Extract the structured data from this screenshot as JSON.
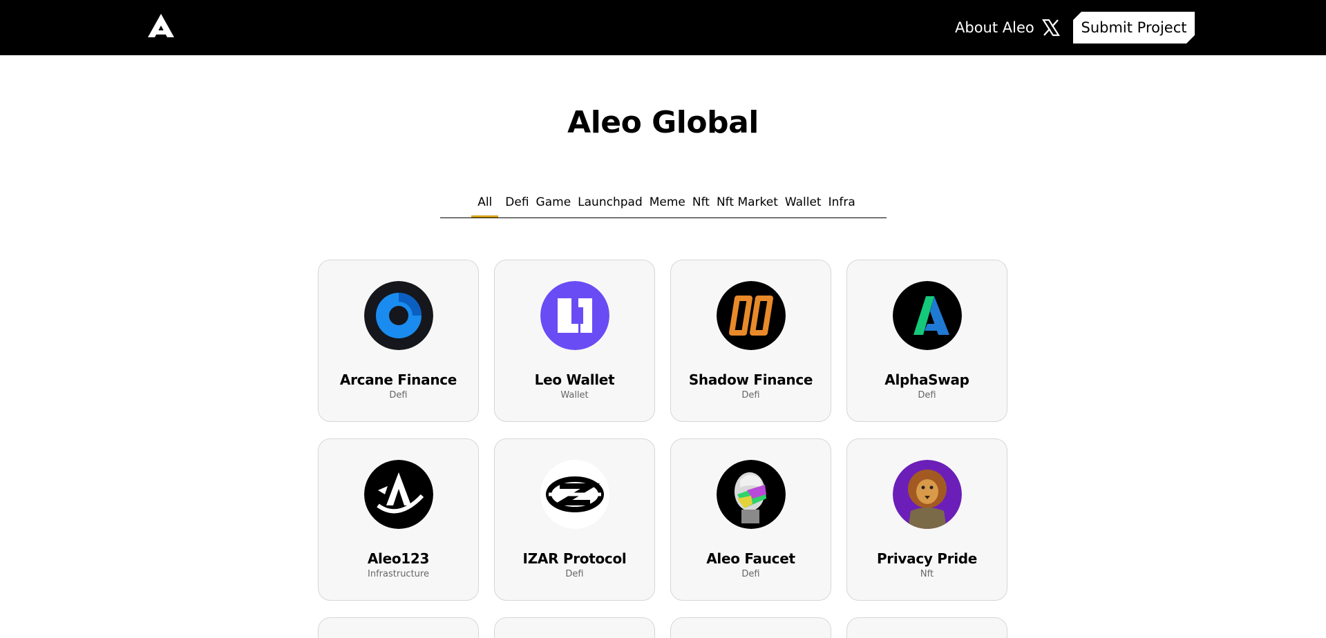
{
  "header": {
    "about_label": "About Aleo",
    "x_icon": "x-twitter-icon",
    "submit_label": "Submit Project",
    "logo_icon": "aleo-logo-icon"
  },
  "page": {
    "title": "Aleo Global"
  },
  "tabs": [
    {
      "label": "All",
      "active": true
    },
    {
      "label": "Defi"
    },
    {
      "label": "Game"
    },
    {
      "label": "Launchpad"
    },
    {
      "label": "Meme"
    },
    {
      "label": "Nft"
    },
    {
      "label": "Nft Market"
    },
    {
      "label": "Wallet"
    },
    {
      "label": "Infra"
    }
  ],
  "colors": {
    "accent": "#d4a017",
    "header_bg": "#000000",
    "card_bg": "#f7f7f7"
  },
  "projects": [
    {
      "name": "Arcane Finance",
      "category": "Defi",
      "icon": "arcane-finance-logo-icon"
    },
    {
      "name": "Leo Wallet",
      "category": "Wallet",
      "icon": "leo-wallet-logo-icon"
    },
    {
      "name": "Shadow Finance",
      "category": "Defi",
      "icon": "shadow-finance-logo-icon"
    },
    {
      "name": "AlphaSwap",
      "category": "Defi",
      "icon": "alphaswap-logo-icon"
    },
    {
      "name": "Aleo123",
      "category": "Infrastructure",
      "icon": "aleo123-logo-icon"
    },
    {
      "name": "IZAR Protocol",
      "category": "Defi",
      "icon": "izar-protocol-logo-icon"
    },
    {
      "name": "Aleo Faucet",
      "category": "Defi",
      "icon": "aleo-faucet-logo-icon"
    },
    {
      "name": "Privacy Pride",
      "category": "Nft",
      "icon": "privacy-pride-logo-icon"
    }
  ]
}
